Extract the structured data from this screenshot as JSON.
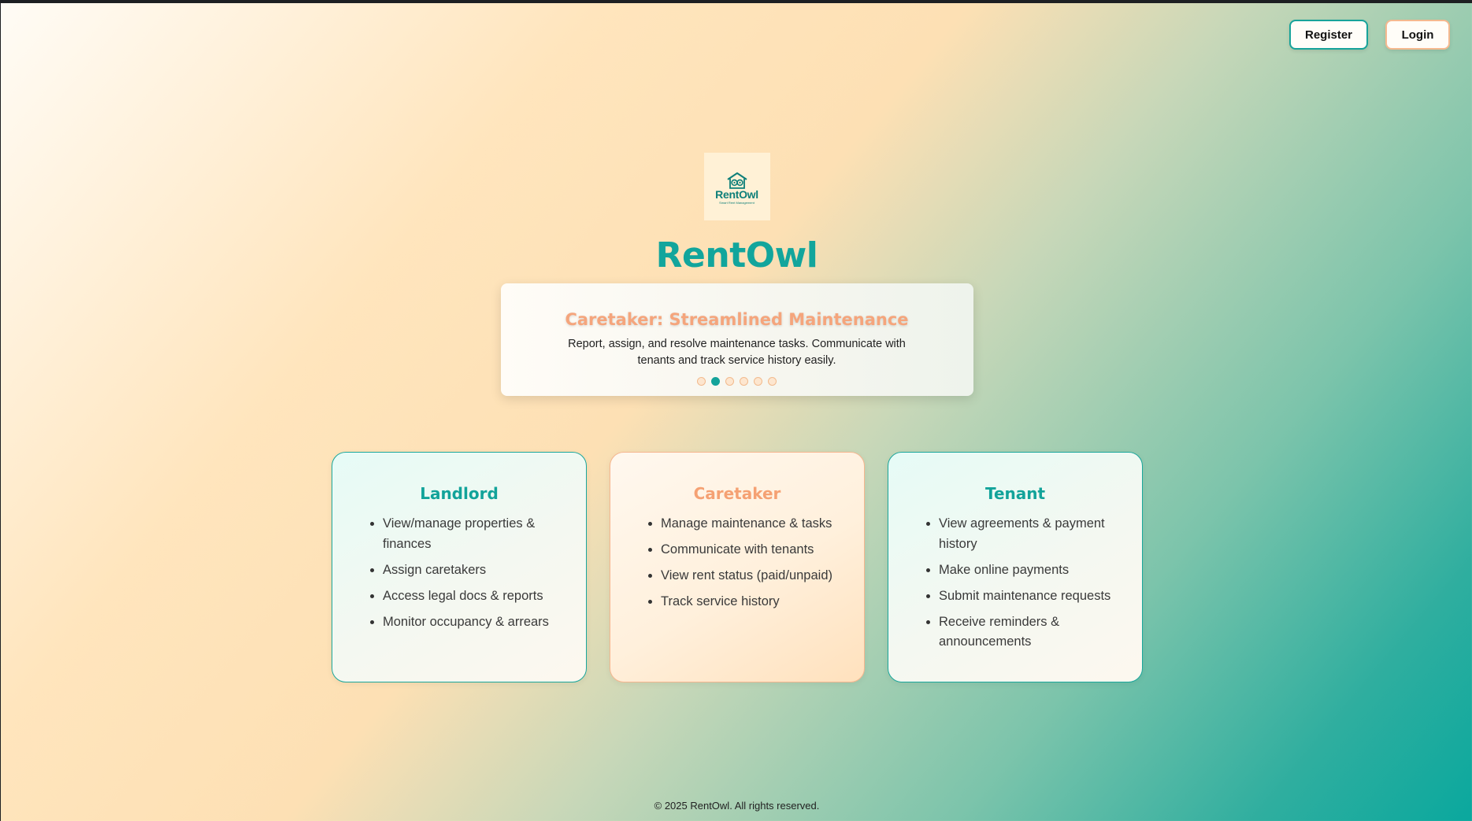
{
  "nav": {
    "register_label": "Register",
    "login_label": "Login"
  },
  "logo": {
    "word": "RentOwl",
    "tagline": "Smart Rent Management"
  },
  "brand": {
    "title": "RentOwl"
  },
  "carousel": {
    "title": "Caretaker: Streamlined Maintenance",
    "description": "Report, assign, and resolve maintenance tasks. Communicate with tenants and track service history easily.",
    "slide_count": 6,
    "active_index": 1
  },
  "cards": [
    {
      "title": "Landlord",
      "items": [
        "View/manage properties & finances",
        "Assign caretakers",
        "Access legal docs & reports",
        "Monitor occupancy & arrears"
      ]
    },
    {
      "title": "Caretaker",
      "items": [
        "Manage maintenance & tasks",
        "Communicate with tenants",
        "View rent status (paid/unpaid)",
        "Track service history"
      ]
    },
    {
      "title": "Tenant",
      "items": [
        "View agreements & payment history",
        "Make online payments",
        "Submit maintenance requests",
        "Receive reminders & announcements"
      ]
    }
  ],
  "footer": {
    "text": "© 2025 RentOwl. All rights reserved."
  },
  "colors": {
    "teal": "#12a39a",
    "peach": "#f5a57c",
    "dot_inactive": "#fde6cf"
  }
}
